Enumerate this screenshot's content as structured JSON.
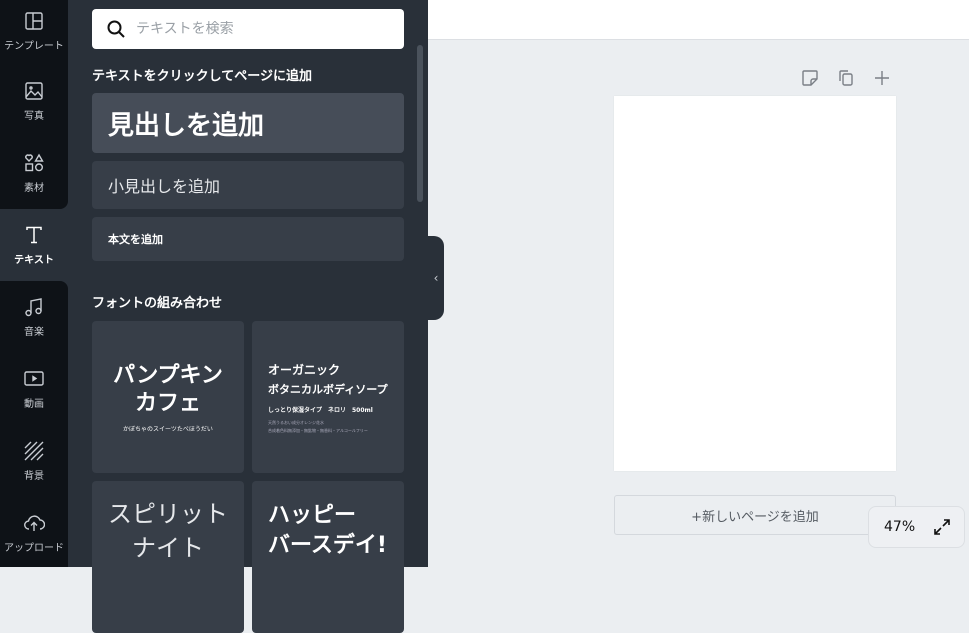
{
  "rail": [
    {
      "label": "テンプレート",
      "icon": "template-icon"
    },
    {
      "label": "写真",
      "icon": "photo-icon"
    },
    {
      "label": "素材",
      "icon": "elements-icon"
    },
    {
      "label": "テキスト",
      "icon": "text-icon"
    },
    {
      "label": "音楽",
      "icon": "music-icon"
    },
    {
      "label": "動画",
      "icon": "video-icon"
    },
    {
      "label": "背景",
      "icon": "background-icon"
    },
    {
      "label": "アップロード",
      "icon": "upload-icon"
    }
  ],
  "panel": {
    "search_placeholder": "テキストを検索",
    "add_section": "テキストをクリックしてページに追加",
    "heading": "見出しを追加",
    "subheading": "小見出しを追加",
    "body": "本文を追加",
    "font_section": "フォントの組み合わせ",
    "cards": [
      {
        "lines": [
          "パンプキン",
          "カフェ"
        ],
        "sub": "かぼちゃのスイーツたべほうだい"
      },
      {
        "lines": [
          "オーガニック",
          "ボタニカルボディソープ"
        ],
        "sub": "しっとり保湿タイプ　ネロリ　500ml",
        "small": [
          "天然うるおい成分オレンジ花水",
          "合成着色料無添加・無鉱物・無香料・アルコールフリー"
        ]
      },
      {
        "lines": [
          "スピリット",
          "ナイト"
        ]
      },
      {
        "lines": [
          "ハッピー",
          "バースデイ!"
        ]
      }
    ]
  },
  "canvas": {
    "add_page": "+新しいページを追加",
    "zoom": "47%"
  }
}
